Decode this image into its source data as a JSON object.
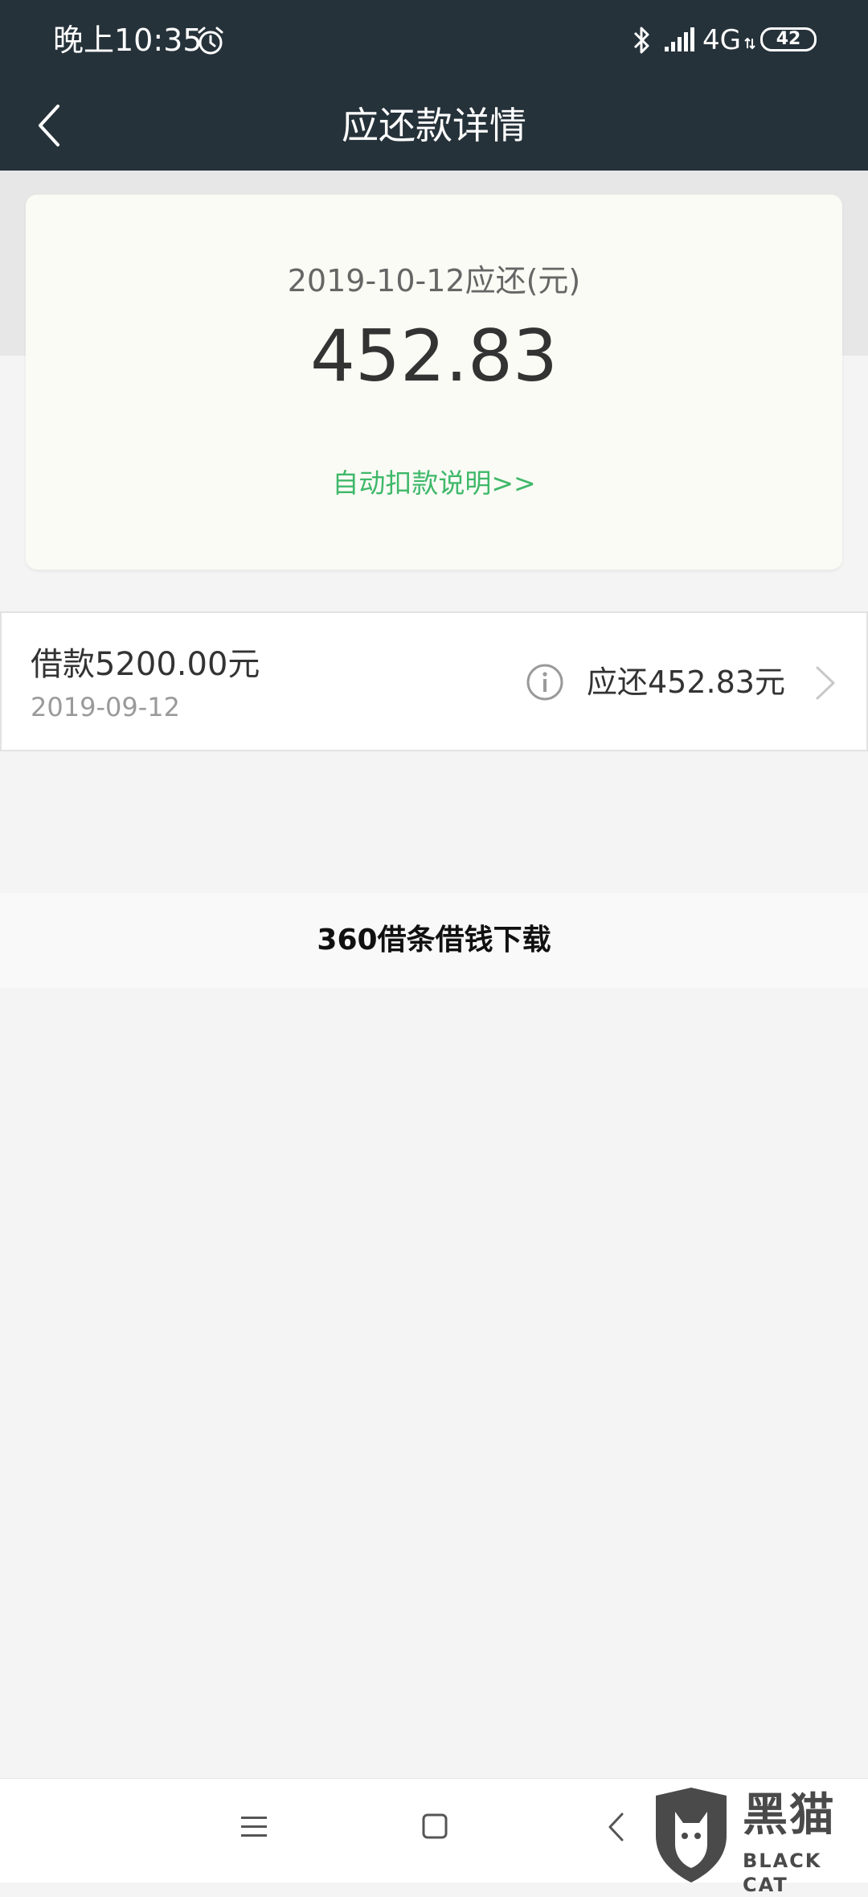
{
  "status_bar": {
    "time": "晚上10:35",
    "network": "4G",
    "battery": "42",
    "icons": [
      "alarm-icon",
      "bluetooth-icon",
      "signal-icon",
      "battery-icon"
    ]
  },
  "app_bar": {
    "title": "应还款详情",
    "back_icon": "chevron-left-icon"
  },
  "summary": {
    "due_label": "2019-10-12应还(元)",
    "due_amount": "452.83",
    "auto_debit_link": "自动扣款说明>>"
  },
  "loan": {
    "title": "借款5200.00元",
    "date": "2019-09-12",
    "due": "应还452.83元",
    "info_icon": "info-icon"
  },
  "download_banner": "360借条借钱下载",
  "nav_bar": {
    "icons": [
      "menu-icon",
      "home-icon",
      "back-icon"
    ]
  },
  "watermark": {
    "text": "黑猫",
    "sub": "BLACK CAT"
  },
  "colors": {
    "header": "#26323a",
    "accent_green": "#3fb86a",
    "page_bg": "#f4f4f4",
    "card_bg": "#fbfbf5"
  }
}
